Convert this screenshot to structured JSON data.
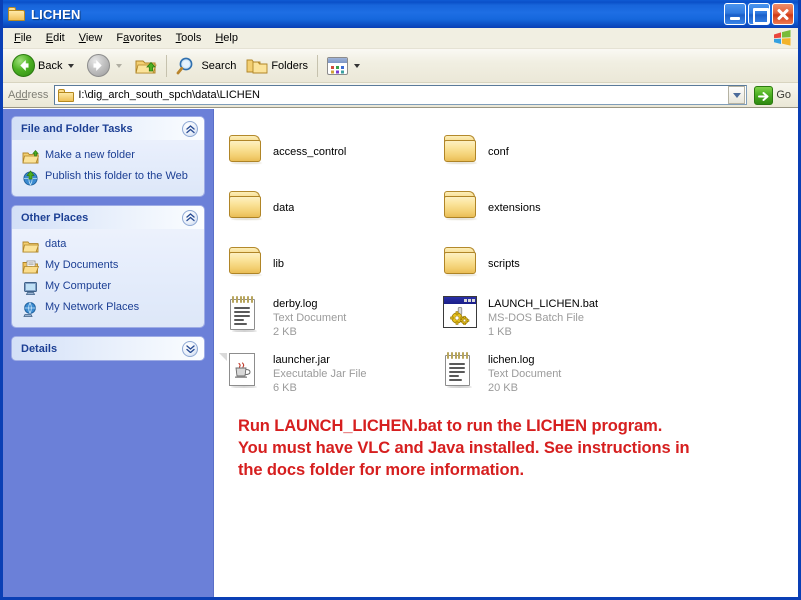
{
  "window": {
    "title": "LICHEN",
    "title_icon": "folder-icon",
    "controls": {
      "minimize": "minimize-button",
      "maximize": "maximize-button",
      "close": "close-button"
    }
  },
  "menubar": {
    "items": [
      {
        "label": "File",
        "accel": "F"
      },
      {
        "label": "Edit",
        "accel": "E"
      },
      {
        "label": "View",
        "accel": "V"
      },
      {
        "label": "Favorites",
        "accel": "a"
      },
      {
        "label": "Tools",
        "accel": "T"
      },
      {
        "label": "Help",
        "accel": "H"
      }
    ],
    "brand_icon": "windows-flag-icon"
  },
  "toolbar": {
    "back_label": "Back",
    "back_icon": "back-arrow-icon",
    "forward_icon": "forward-arrow-icon",
    "up_icon": "up-folder-icon",
    "search_label": "Search",
    "search_icon": "magnifier-icon",
    "folders_label": "Folders",
    "folders_icon": "folders-icon",
    "views_icon": "views-icon"
  },
  "address": {
    "label": "Address",
    "label_accel": "dd",
    "path": "I:\\dig_arch_south_spch\\data\\LICHEN",
    "folder_icon": "folder-icon",
    "dropdown_icon": "chevron-down-icon",
    "go_label": "Go",
    "go_icon": "go-arrow-icon"
  },
  "sidebar": {
    "panels": [
      {
        "title": "File and Folder Tasks",
        "collapse_icon": "chevron-up-icon",
        "collapsed": false,
        "items": [
          {
            "label": "Make a new folder",
            "icon": "new-folder-icon"
          },
          {
            "label": "Publish this folder to the Web",
            "icon": "publish-web-icon"
          }
        ]
      },
      {
        "title": "Other Places",
        "collapse_icon": "chevron-up-icon",
        "collapsed": false,
        "items": [
          {
            "label": "data",
            "icon": "folder-icon"
          },
          {
            "label": "My Documents",
            "icon": "my-documents-icon"
          },
          {
            "label": "My Computer",
            "icon": "my-computer-icon"
          },
          {
            "label": "My Network Places",
            "icon": "network-places-icon"
          }
        ]
      },
      {
        "title": "Details",
        "collapse_icon": "chevron-down-icon",
        "collapsed": true,
        "items": []
      }
    ]
  },
  "files": [
    {
      "name": "access_control",
      "type": "",
      "size": "",
      "kind": "folder",
      "icon": "folder-icon"
    },
    {
      "name": "conf",
      "type": "",
      "size": "",
      "kind": "folder",
      "icon": "folder-icon"
    },
    {
      "name": "data",
      "type": "",
      "size": "",
      "kind": "folder",
      "icon": "folder-icon"
    },
    {
      "name": "extensions",
      "type": "",
      "size": "",
      "kind": "folder",
      "icon": "folder-icon"
    },
    {
      "name": "lib",
      "type": "",
      "size": "",
      "kind": "folder",
      "icon": "folder-icon"
    },
    {
      "name": "scripts",
      "type": "",
      "size": "",
      "kind": "folder",
      "icon": "folder-icon"
    },
    {
      "name": "derby.log",
      "type": "Text Document",
      "size": "2 KB",
      "kind": "file",
      "icon": "text-document-icon"
    },
    {
      "name": "LAUNCH_LICHEN.bat",
      "type": "MS-DOS Batch File",
      "size": "1 KB",
      "kind": "file",
      "icon": "batch-file-icon"
    },
    {
      "name": "launcher.jar",
      "type": "Executable Jar File",
      "size": "6 KB",
      "kind": "file",
      "icon": "jar-file-icon"
    },
    {
      "name": "lichen.log",
      "type": "Text Document",
      "size": "20 KB",
      "kind": "file",
      "icon": "text-document-icon"
    }
  ],
  "note": {
    "line1": "Run LAUNCH_LICHEN.bat to run the LICHEN program.",
    "line2": "You must have VLC and Java installed. See instructions in",
    "line3": "the docs folder for more information.",
    "color": "#d61f1f"
  },
  "colors": {
    "titlebar_blue": "#1e6ee4",
    "frame_blue": "#0a3fb5",
    "sidebar_blue": "#6b80d8",
    "panel_title": "#1c3f94",
    "link_blue": "#1c3f94",
    "chrome_beige": "#f1efe2",
    "meta_gray": "#9b9b9b"
  }
}
